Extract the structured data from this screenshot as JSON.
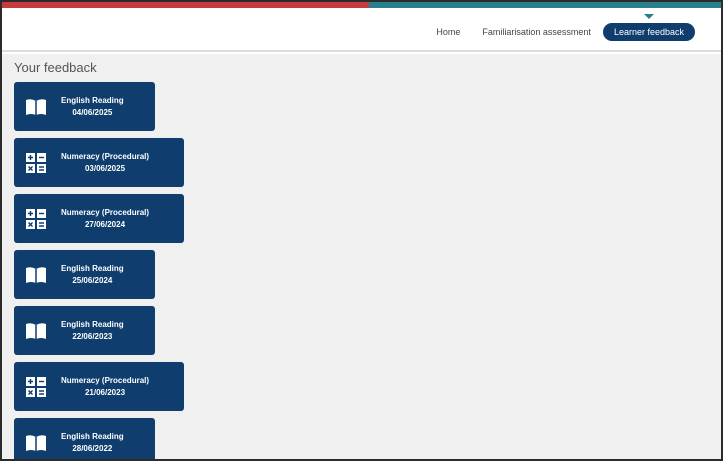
{
  "nav": {
    "home": "Home",
    "familiarisation": "Familiarisation assessment",
    "learner_feedback": "Learner feedback"
  },
  "page_title": "Your feedback",
  "colors": {
    "card_bg": "#0f3d6e",
    "stripe_red": "#c93a3f",
    "stripe_teal": "#2a7f8f"
  },
  "feedback": [
    {
      "title": "English Reading",
      "date": "04/06/2025",
      "icon": "book-icon"
    },
    {
      "title": "Numeracy (Procedural)",
      "date": "03/06/2025",
      "icon": "math-symbols-icon"
    },
    {
      "title": "Numeracy (Procedural)",
      "date": "27/06/2024",
      "icon": "math-symbols-icon"
    },
    {
      "title": "English Reading",
      "date": "25/06/2024",
      "icon": "book-icon"
    },
    {
      "title": "English Reading",
      "date": "22/06/2023",
      "icon": "book-icon"
    },
    {
      "title": "Numeracy (Procedural)",
      "date": "21/06/2023",
      "icon": "math-symbols-icon"
    },
    {
      "title": "English Reading",
      "date": "28/06/2022",
      "icon": "book-icon"
    }
  ]
}
